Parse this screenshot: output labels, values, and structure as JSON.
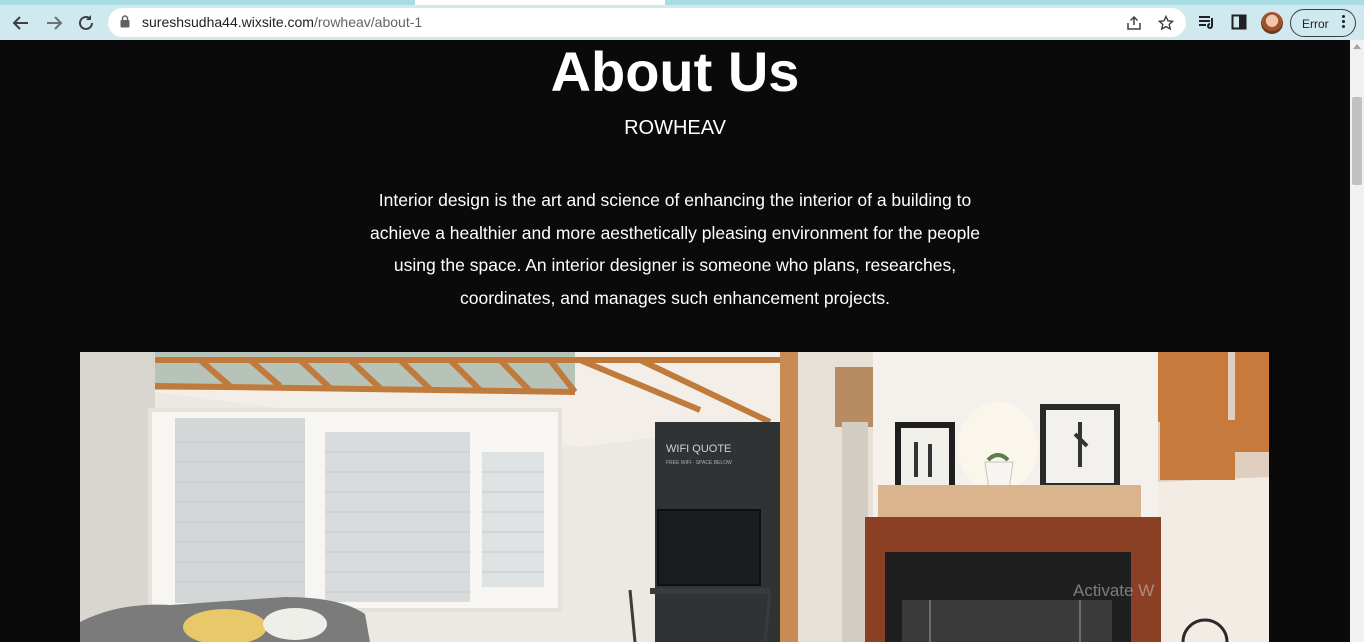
{
  "browser": {
    "url_host": "sureshsudha44.wixsite.com",
    "url_path": "/rowheav/about-1",
    "profile_status": "Error",
    "icons": [
      "back-icon",
      "forward-icon",
      "reload-icon",
      "lock-icon",
      "share-icon",
      "star-icon",
      "reading-list-icon",
      "side-panel-icon",
      "avatar",
      "more-icon"
    ]
  },
  "page": {
    "title": "About Us",
    "subtitle": "ROWHEAV",
    "paragraph_lines": [
      "Interior design is the art and science of enhancing the interior of a building to",
      "achieve a healthier and more aesthetically pleasing environment for the people",
      "using the space. An interior designer is someone who plans, researches,",
      "coordinates, and manages such enhancement projects."
    ],
    "hero_image": {
      "description_icon": "living-room-photo",
      "sign_text": "WIFI QUOTE",
      "sign_subtext": "FREE WIFI · SPACE BELOW"
    },
    "watermark": "Activate W"
  },
  "colors": {
    "chrome_bg": "#cfe9ef",
    "page_bg": "#0b0a0a",
    "text": "#ffffff"
  }
}
